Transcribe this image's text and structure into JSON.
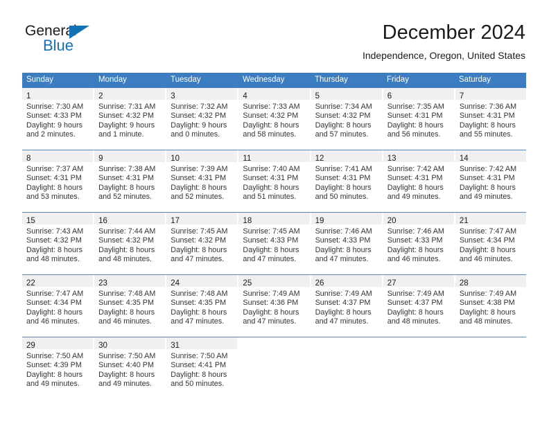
{
  "brand": {
    "name_part1": "General",
    "name_part2": "Blue",
    "triangle_color": "#1272b8"
  },
  "header": {
    "title": "December 2024",
    "subtitle": "Independence, Oregon, United States"
  },
  "theme": {
    "header_blue": "#3b7dc0",
    "day_band_gray": "#f0f0f0",
    "row_divider": "#5b87b5",
    "text": "#333333"
  },
  "weekdays": [
    "Sunday",
    "Monday",
    "Tuesday",
    "Wednesday",
    "Thursday",
    "Friday",
    "Saturday"
  ],
  "weeks": [
    [
      {
        "day": "1",
        "sunrise": "Sunrise: 7:30 AM",
        "sunset": "Sunset: 4:33 PM",
        "daylight1": "Daylight: 9 hours",
        "daylight2": "and 2 minutes."
      },
      {
        "day": "2",
        "sunrise": "Sunrise: 7:31 AM",
        "sunset": "Sunset: 4:32 PM",
        "daylight1": "Daylight: 9 hours",
        "daylight2": "and 1 minute."
      },
      {
        "day": "3",
        "sunrise": "Sunrise: 7:32 AM",
        "sunset": "Sunset: 4:32 PM",
        "daylight1": "Daylight: 9 hours",
        "daylight2": "and 0 minutes."
      },
      {
        "day": "4",
        "sunrise": "Sunrise: 7:33 AM",
        "sunset": "Sunset: 4:32 PM",
        "daylight1": "Daylight: 8 hours",
        "daylight2": "and 58 minutes."
      },
      {
        "day": "5",
        "sunrise": "Sunrise: 7:34 AM",
        "sunset": "Sunset: 4:32 PM",
        "daylight1": "Daylight: 8 hours",
        "daylight2": "and 57 minutes."
      },
      {
        "day": "6",
        "sunrise": "Sunrise: 7:35 AM",
        "sunset": "Sunset: 4:31 PM",
        "daylight1": "Daylight: 8 hours",
        "daylight2": "and 56 minutes."
      },
      {
        "day": "7",
        "sunrise": "Sunrise: 7:36 AM",
        "sunset": "Sunset: 4:31 PM",
        "daylight1": "Daylight: 8 hours",
        "daylight2": "and 55 minutes."
      }
    ],
    [
      {
        "day": "8",
        "sunrise": "Sunrise: 7:37 AM",
        "sunset": "Sunset: 4:31 PM",
        "daylight1": "Daylight: 8 hours",
        "daylight2": "and 53 minutes."
      },
      {
        "day": "9",
        "sunrise": "Sunrise: 7:38 AM",
        "sunset": "Sunset: 4:31 PM",
        "daylight1": "Daylight: 8 hours",
        "daylight2": "and 52 minutes."
      },
      {
        "day": "10",
        "sunrise": "Sunrise: 7:39 AM",
        "sunset": "Sunset: 4:31 PM",
        "daylight1": "Daylight: 8 hours",
        "daylight2": "and 52 minutes."
      },
      {
        "day": "11",
        "sunrise": "Sunrise: 7:40 AM",
        "sunset": "Sunset: 4:31 PM",
        "daylight1": "Daylight: 8 hours",
        "daylight2": "and 51 minutes."
      },
      {
        "day": "12",
        "sunrise": "Sunrise: 7:41 AM",
        "sunset": "Sunset: 4:31 PM",
        "daylight1": "Daylight: 8 hours",
        "daylight2": "and 50 minutes."
      },
      {
        "day": "13",
        "sunrise": "Sunrise: 7:42 AM",
        "sunset": "Sunset: 4:31 PM",
        "daylight1": "Daylight: 8 hours",
        "daylight2": "and 49 minutes."
      },
      {
        "day": "14",
        "sunrise": "Sunrise: 7:42 AM",
        "sunset": "Sunset: 4:31 PM",
        "daylight1": "Daylight: 8 hours",
        "daylight2": "and 49 minutes."
      }
    ],
    [
      {
        "day": "15",
        "sunrise": "Sunrise: 7:43 AM",
        "sunset": "Sunset: 4:32 PM",
        "daylight1": "Daylight: 8 hours",
        "daylight2": "and 48 minutes."
      },
      {
        "day": "16",
        "sunrise": "Sunrise: 7:44 AM",
        "sunset": "Sunset: 4:32 PM",
        "daylight1": "Daylight: 8 hours",
        "daylight2": "and 48 minutes."
      },
      {
        "day": "17",
        "sunrise": "Sunrise: 7:45 AM",
        "sunset": "Sunset: 4:32 PM",
        "daylight1": "Daylight: 8 hours",
        "daylight2": "and 47 minutes."
      },
      {
        "day": "18",
        "sunrise": "Sunrise: 7:45 AM",
        "sunset": "Sunset: 4:33 PM",
        "daylight1": "Daylight: 8 hours",
        "daylight2": "and 47 minutes."
      },
      {
        "day": "19",
        "sunrise": "Sunrise: 7:46 AM",
        "sunset": "Sunset: 4:33 PM",
        "daylight1": "Daylight: 8 hours",
        "daylight2": "and 47 minutes."
      },
      {
        "day": "20",
        "sunrise": "Sunrise: 7:46 AM",
        "sunset": "Sunset: 4:33 PM",
        "daylight1": "Daylight: 8 hours",
        "daylight2": "and 46 minutes."
      },
      {
        "day": "21",
        "sunrise": "Sunrise: 7:47 AM",
        "sunset": "Sunset: 4:34 PM",
        "daylight1": "Daylight: 8 hours",
        "daylight2": "and 46 minutes."
      }
    ],
    [
      {
        "day": "22",
        "sunrise": "Sunrise: 7:47 AM",
        "sunset": "Sunset: 4:34 PM",
        "daylight1": "Daylight: 8 hours",
        "daylight2": "and 46 minutes."
      },
      {
        "day": "23",
        "sunrise": "Sunrise: 7:48 AM",
        "sunset": "Sunset: 4:35 PM",
        "daylight1": "Daylight: 8 hours",
        "daylight2": "and 46 minutes."
      },
      {
        "day": "24",
        "sunrise": "Sunrise: 7:48 AM",
        "sunset": "Sunset: 4:35 PM",
        "daylight1": "Daylight: 8 hours",
        "daylight2": "and 47 minutes."
      },
      {
        "day": "25",
        "sunrise": "Sunrise: 7:49 AM",
        "sunset": "Sunset: 4:36 PM",
        "daylight1": "Daylight: 8 hours",
        "daylight2": "and 47 minutes."
      },
      {
        "day": "26",
        "sunrise": "Sunrise: 7:49 AM",
        "sunset": "Sunset: 4:37 PM",
        "daylight1": "Daylight: 8 hours",
        "daylight2": "and 47 minutes."
      },
      {
        "day": "27",
        "sunrise": "Sunrise: 7:49 AM",
        "sunset": "Sunset: 4:37 PM",
        "daylight1": "Daylight: 8 hours",
        "daylight2": "and 48 minutes."
      },
      {
        "day": "28",
        "sunrise": "Sunrise: 7:49 AM",
        "sunset": "Sunset: 4:38 PM",
        "daylight1": "Daylight: 8 hours",
        "daylight2": "and 48 minutes."
      }
    ],
    [
      {
        "day": "29",
        "sunrise": "Sunrise: 7:50 AM",
        "sunset": "Sunset: 4:39 PM",
        "daylight1": "Daylight: 8 hours",
        "daylight2": "and 49 minutes."
      },
      {
        "day": "30",
        "sunrise": "Sunrise: 7:50 AM",
        "sunset": "Sunset: 4:40 PM",
        "daylight1": "Daylight: 8 hours",
        "daylight2": "and 49 minutes."
      },
      {
        "day": "31",
        "sunrise": "Sunrise: 7:50 AM",
        "sunset": "Sunset: 4:41 PM",
        "daylight1": "Daylight: 8 hours",
        "daylight2": "and 50 minutes."
      },
      {
        "day": "",
        "sunrise": "",
        "sunset": "",
        "daylight1": "",
        "daylight2": ""
      },
      {
        "day": "",
        "sunrise": "",
        "sunset": "",
        "daylight1": "",
        "daylight2": ""
      },
      {
        "day": "",
        "sunrise": "",
        "sunset": "",
        "daylight1": "",
        "daylight2": ""
      },
      {
        "day": "",
        "sunrise": "",
        "sunset": "",
        "daylight1": "",
        "daylight2": ""
      }
    ]
  ]
}
